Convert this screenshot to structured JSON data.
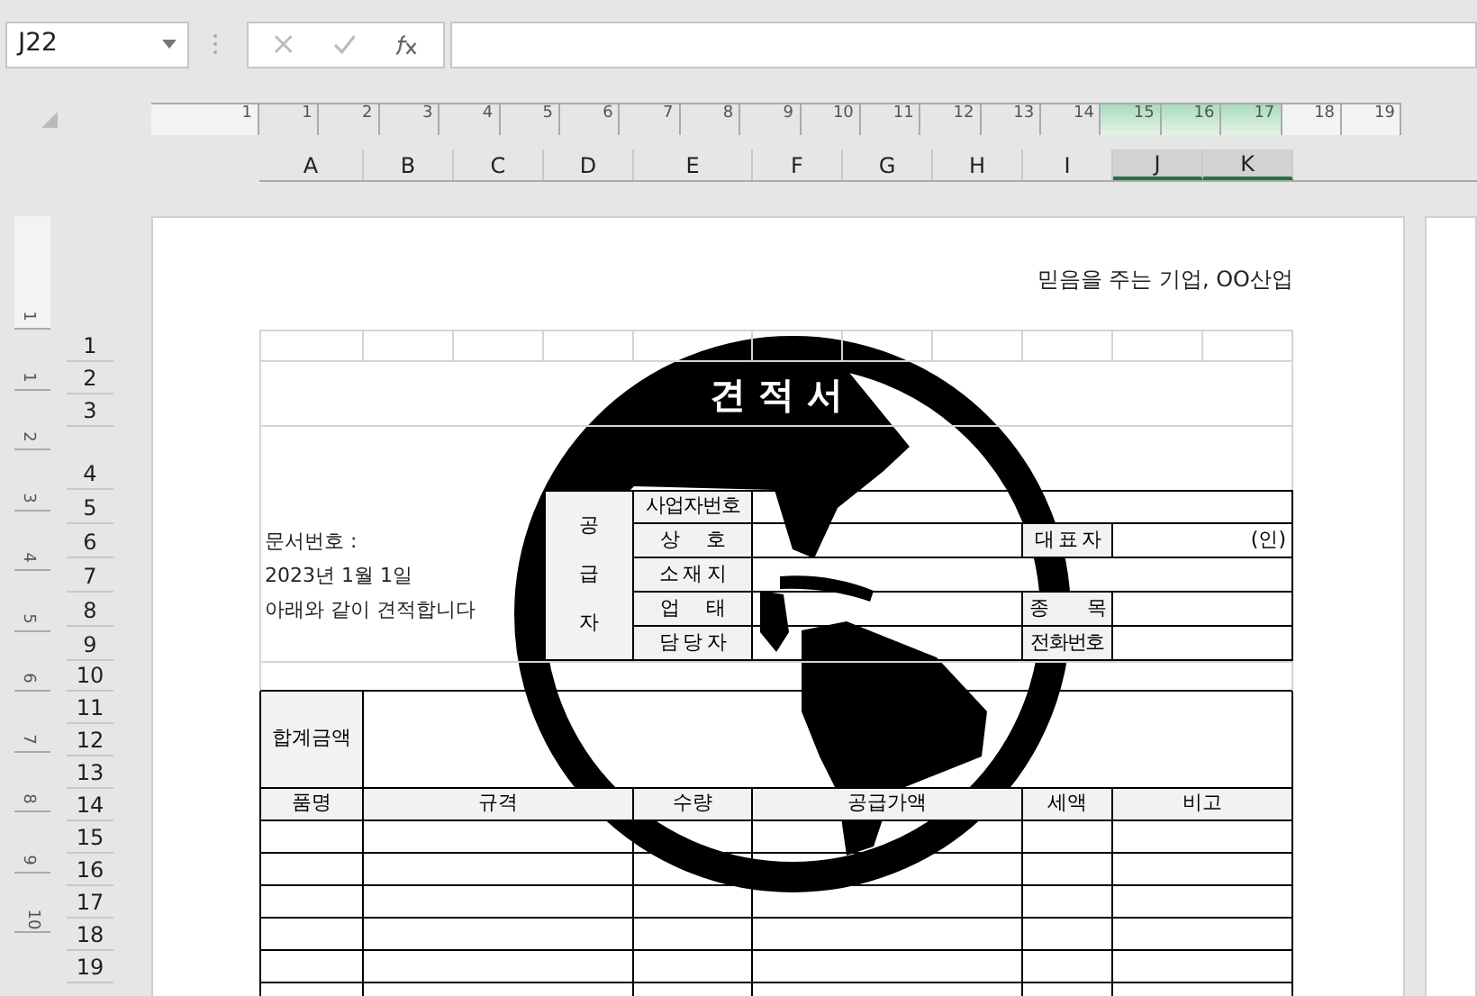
{
  "name_box": "J22",
  "ruler": {
    "marks": [
      {
        "label": "1",
        "kind": "margin"
      },
      {
        "label": "1",
        "kind": "page"
      },
      {
        "label": "2",
        "kind": "page"
      },
      {
        "label": "3",
        "kind": "page"
      },
      {
        "label": "4",
        "kind": "page"
      },
      {
        "label": "5",
        "kind": "page"
      },
      {
        "label": "6",
        "kind": "page"
      },
      {
        "label": "7",
        "kind": "page"
      },
      {
        "label": "8",
        "kind": "page"
      },
      {
        "label": "9",
        "kind": "page"
      },
      {
        "label": "10",
        "kind": "page"
      },
      {
        "label": "11",
        "kind": "page"
      },
      {
        "label": "12",
        "kind": "page"
      },
      {
        "label": "13",
        "kind": "page"
      },
      {
        "label": "14",
        "kind": "page"
      },
      {
        "label": "15",
        "kind": "selected"
      },
      {
        "label": "16",
        "kind": "selected"
      },
      {
        "label": "17",
        "kind": "selected"
      },
      {
        "label": "18",
        "kind": "margin"
      },
      {
        "label": "19",
        "kind": "margin"
      }
    ]
  },
  "vertical_ruler": {
    "marks": [
      {
        "label": "1",
        "kind": "margin"
      },
      {
        "label": "1",
        "kind": "page"
      },
      {
        "label": "2",
        "kind": "page"
      },
      {
        "label": "3",
        "kind": "page"
      },
      {
        "label": "4",
        "kind": "page"
      },
      {
        "label": "5",
        "kind": "page"
      },
      {
        "label": "6",
        "kind": "page"
      },
      {
        "label": "7",
        "kind": "page"
      },
      {
        "label": "8",
        "kind": "page"
      },
      {
        "label": "9",
        "kind": "page"
      },
      {
        "label": "10",
        "kind": "page"
      }
    ]
  },
  "columns": [
    {
      "label": "A",
      "selected": false
    },
    {
      "label": "B",
      "selected": false
    },
    {
      "label": "C",
      "selected": false
    },
    {
      "label": "D",
      "selected": false
    },
    {
      "label": "E",
      "selected": false
    },
    {
      "label": "F",
      "selected": false
    },
    {
      "label": "G",
      "selected": false
    },
    {
      "label": "H",
      "selected": false
    },
    {
      "label": "I",
      "selected": false
    },
    {
      "label": "J",
      "selected": true
    },
    {
      "label": "K",
      "selected": true
    }
  ],
  "rows": [
    "1",
    "2",
    "3",
    "4",
    "5",
    "6",
    "7",
    "8",
    "9",
    "10",
    "11",
    "12",
    "13",
    "14",
    "15",
    "16",
    "17",
    "18",
    "19"
  ],
  "sheet": {
    "slogan": "믿음을 주는 기업, OO산업",
    "title": "견 적 서",
    "doc_info": [
      "문서번호 :",
      "2023년 1월 1일",
      "아래와 같이 견적합니다"
    ],
    "supplier": {
      "side_label": [
        "공",
        "급",
        "자"
      ],
      "fields": [
        {
          "label": "사업자번호"
        },
        {
          "label": "상     호",
          "extra_label": "대 표 자",
          "extra_value": "(인)"
        },
        {
          "label": "소 재 지"
        },
        {
          "label": "업     태",
          "extra_label": "종        목"
        },
        {
          "label": "담 당 자",
          "extra_label": "전화번호"
        }
      ]
    },
    "total_label": "합계금액",
    "item_columns": [
      "품명",
      "규격",
      "수량",
      "공급가액",
      "세액",
      "비고"
    ]
  }
}
